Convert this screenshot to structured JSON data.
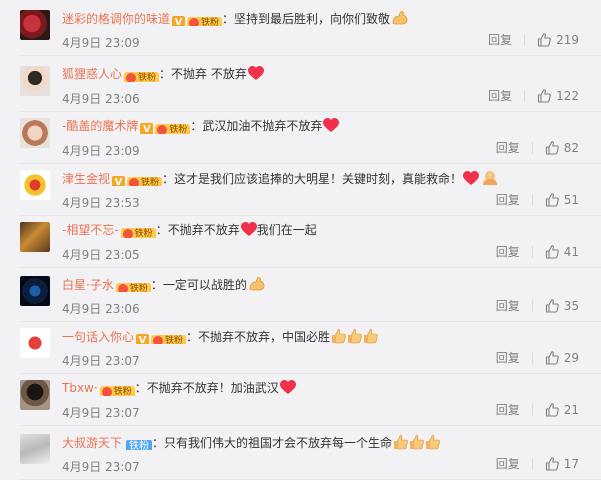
{
  "reply_label": "回复",
  "colors": {
    "name": "#eb7350",
    "meta": "#808080",
    "heart": "#f0314b",
    "vip": "#f6a623",
    "fan": "#ffc94b"
  },
  "comments": [
    {
      "user": "迷彩的格调你的味道",
      "vip": true,
      "fan_badge": "铁粉",
      "text": "：坚持到最后胜利，向你们致敬",
      "emojis": [
        "strong-arm-icon"
      ],
      "time": "4月9日 23:09",
      "likes": "219"
    },
    {
      "user": "狐狸惑人心",
      "vip": false,
      "fan_badge": "铁粉",
      "text": "：不抛弃 不放弃",
      "emojis": [
        "heart-icon"
      ],
      "time": "4月9日 23:06",
      "likes": "122"
    },
    {
      "user": "-酷盖的魔术牌",
      "vip": true,
      "fan_badge": "铁粉",
      "text": "：武汉加油不抛弃不放弃",
      "emojis": [
        "heart-icon"
      ],
      "time": "4月9日 23:09",
      "likes": "82"
    },
    {
      "user": "津生金视",
      "vip": true,
      "fan_badge": "铁粉",
      "text": "：这才是我们应该追捧的大明星！关键时刻，真能救命！",
      "emojis": [
        "heart-icon",
        "pray-icon"
      ],
      "time": "4月9日 23:53",
      "likes": "51"
    },
    {
      "user": "-相望不忘-",
      "vip": false,
      "fan_badge": "铁粉",
      "text": "：不抛弃不放弃",
      "text_after": "我们在一起",
      "emojis": [
        "heart-icon"
      ],
      "time": "4月9日 23:05",
      "likes": "41"
    },
    {
      "user": "白星·子水",
      "vip": false,
      "fan_badge": "铁粉",
      "text": "：一定可以战胜的",
      "emojis": [
        "strong-arm-icon"
      ],
      "time": "4月9日 23:06",
      "likes": "35"
    },
    {
      "user": "一句话入你心",
      "vip": true,
      "fan_badge": "铁粉",
      "text": "：不抛弃不放弃，中国必胜",
      "emojis": [
        "thumbs-up-icon",
        "thumbs-up-icon",
        "thumbs-up-icon"
      ],
      "time": "4月9日 23:07",
      "likes": "29"
    },
    {
      "user": "Tbxw·",
      "vip": false,
      "fan_badge": "铁粉",
      "text": "：不抛弃不放弃！加油武汉",
      "emojis": [
        "heart-icon"
      ],
      "time": "4月9日 23:07",
      "likes": "21"
    },
    {
      "user": "大叔游天下",
      "vip": false,
      "fan_badge": "铁粉",
      "plain_fan": true,
      "text": "：只有我们伟大的祖国才会不放弃每一个生命",
      "emojis": [
        "thumbs-up-icon",
        "thumbs-up-icon",
        "thumbs-up-icon"
      ],
      "time": "4月9日 23:07",
      "likes": "17"
    }
  ]
}
